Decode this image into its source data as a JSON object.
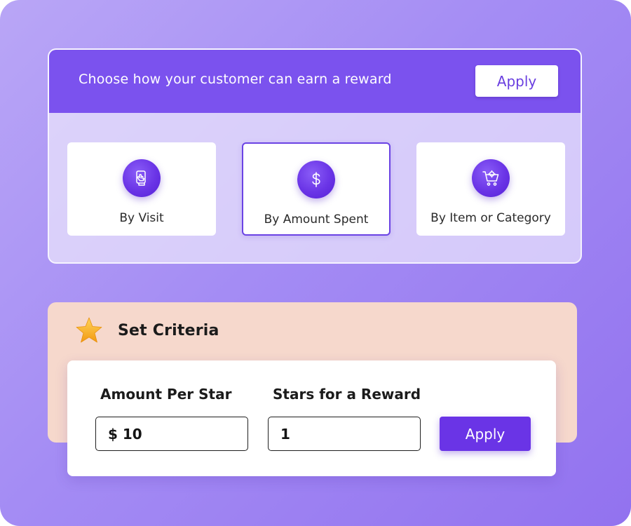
{
  "header": {
    "title": "Choose how your customer can earn a reward",
    "apply_label": "Apply"
  },
  "options": [
    {
      "label": "By Visit",
      "icon": "phone-tap-icon",
      "selected": false
    },
    {
      "label": "By Amount Spent",
      "icon": "dollar-icon",
      "selected": true
    },
    {
      "label": "By Item or Category",
      "icon": "shopping-cart-icon",
      "selected": false
    }
  ],
  "criteria": {
    "title": "Set Criteria",
    "icon": "star-icon",
    "amount_label": "Amount Per Star",
    "amount_value": "$ 10",
    "stars_label": "Stars for a Reward",
    "stars_value": "1",
    "apply_label": "Apply"
  },
  "colors": {
    "accent": "#7b52ee",
    "button_primary": "#6a34e6",
    "criteria_background": "#f6d8cc",
    "star": "#f7a41c"
  }
}
